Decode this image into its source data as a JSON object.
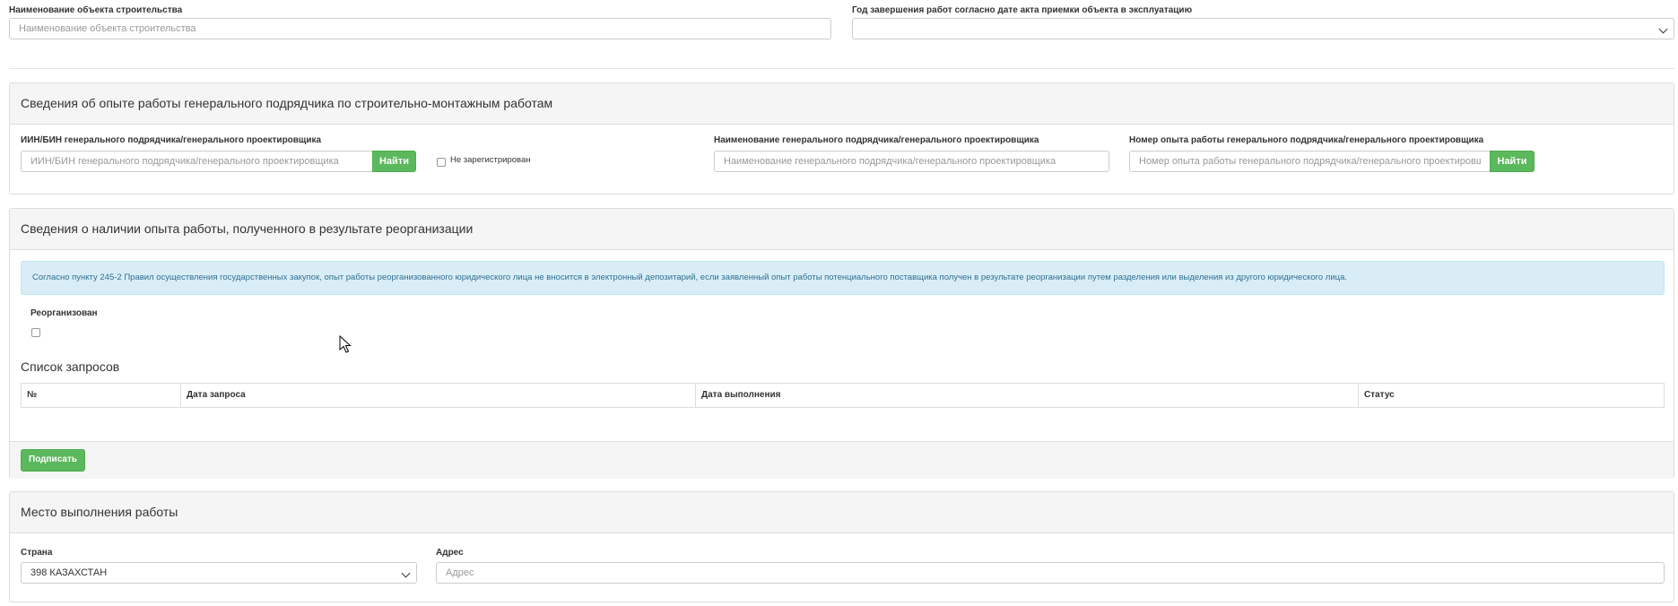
{
  "top": {
    "object_name_label": "Наименование объекта строительства",
    "object_name_placeholder": "Наименование объекта строительства",
    "completion_year_label": "Год завершения работ согласно дате акта приемки объекта в эксплуатацию",
    "completion_year_value": ""
  },
  "experience": {
    "title": "Сведения об опыте работы генерального подрядчика по строительно-монтажным работам",
    "iin_label": "ИИН/БИН генерального подрядчика/генерального проектировщика",
    "iin_placeholder": "ИИН/БИН генерального подрядчика/генерального проектировщика",
    "find_label": "Найти",
    "not_registered_label": "Не зарегистрирован",
    "contractor_name_label": "Наименование генерального подрядчика/генерального проектировщика",
    "contractor_name_placeholder": "Наименование генерального подрядчика/генерального проектировщика",
    "experience_number_label": "Номер опыта работы генерального подрядчика/генерального проектировщика",
    "experience_number_placeholder": "Номер опыта работы генерального подрядчика/генерального проектировщика",
    "find2_label": "Найти"
  },
  "reorganization": {
    "title": "Сведения о наличии опыта работы, полученного в результате реорганизации",
    "notice": "Согласно пункту 245-2 Правил осуществления государственных закупок, опыт работы реорганизованного юридического лица не вносится в электронный депозитарий, если заявленный опыт работы потенциального поставщика получен в результате реорганизации путем разделения или выделения из другого юридического лица.",
    "reorganized_label": "Реорганизован",
    "requests_title": "Список запросов",
    "columns": [
      "№",
      "Дата запроса",
      "Дата выполнения",
      "Статус"
    ],
    "sign_label": "Подписать"
  },
  "location": {
    "title": "Место выполнения работы",
    "country_label": "Страна",
    "country_value": "398 КАЗАХСТАН",
    "address_label": "Адрес",
    "address_placeholder": "Адрес"
  },
  "colors": {
    "primary_green": "#5cb85c",
    "alert_bg": "#d9edf7",
    "alert_text": "#31708f",
    "panel_head_bg": "#f5f5f5"
  }
}
